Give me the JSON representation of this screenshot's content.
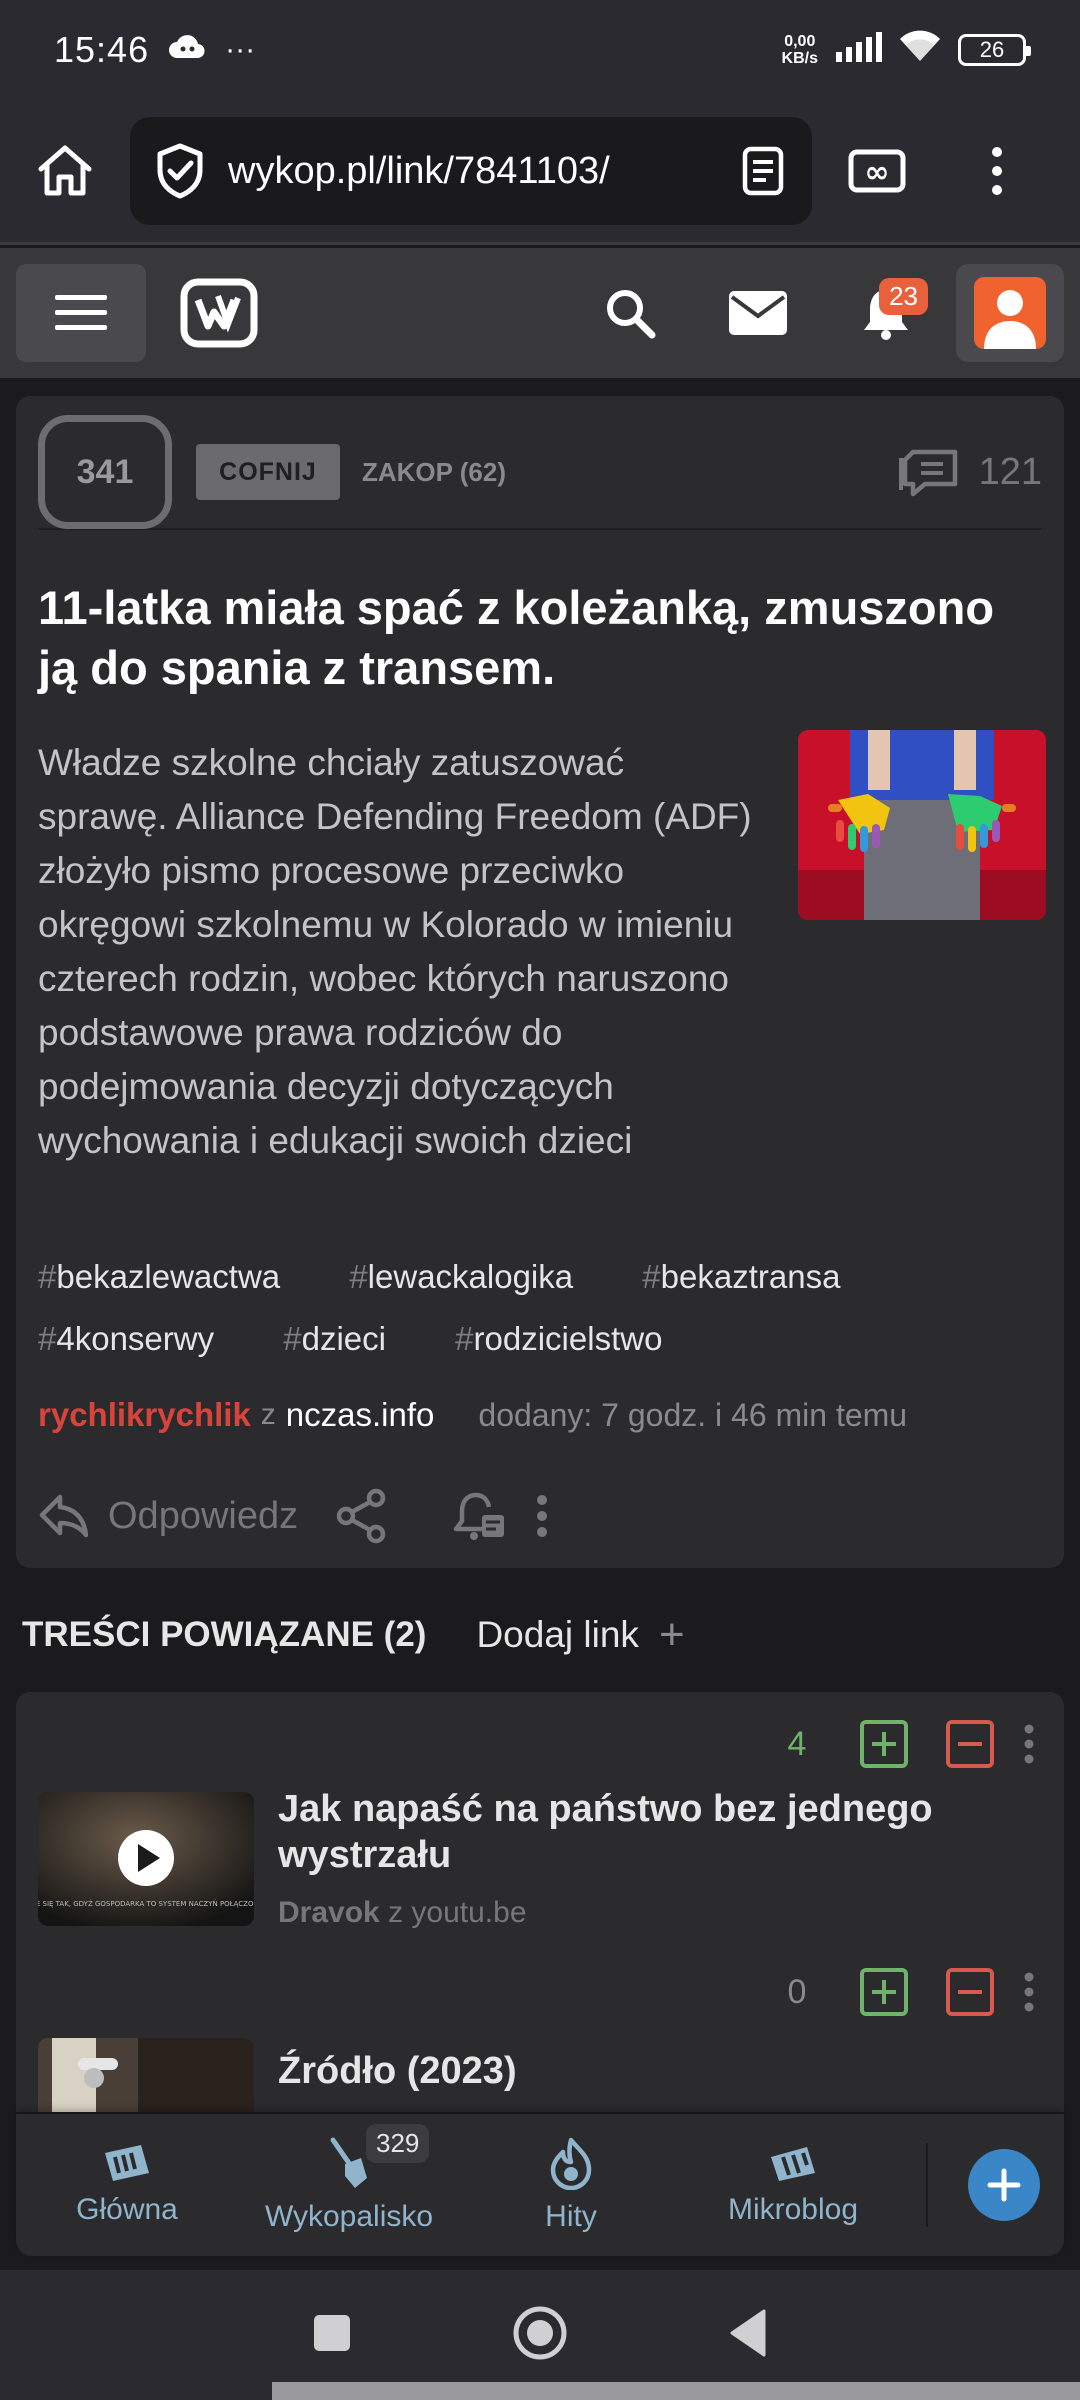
{
  "status_bar": {
    "time": "15:46",
    "more": "···",
    "net_speed_value": "0,00",
    "net_speed_unit": "KB/s",
    "battery": "26"
  },
  "browser": {
    "url": "wykop.pl/link/7841103/"
  },
  "header": {
    "notification_count": "23"
  },
  "article": {
    "votes": "341",
    "undo_label": "COFNIJ",
    "bury_label": "ZAKOP (62)",
    "comment_count": "121",
    "title": "11-latka miała spać z koleżanką, zmuszono ją do spania z transem.",
    "description": "Władze szkolne chciały zatuszować sprawę. Alliance Defending Freedom (ADF) złożyło pismo procesowe przeciwko okręgowi szkolnemu w Kolorado w imieniu czterech rodzin, wobec których naruszono podstawowe prawa rodziców do podejmowania decyzji dotyczących wychowania i edukacji swoich dzieci",
    "tags": [
      "bekazlewactwa",
      "lewackalogika",
      "bekaztransa",
      "4konserwy",
      "dzieci",
      "rodzicielstwo"
    ],
    "author": "rychlikrychlik",
    "from_word": "z",
    "source": "nczas.info",
    "added": "dodany: 7 godz. i 46 min temu",
    "reply_label": "Odpowiedz"
  },
  "related": {
    "heading": "TREŚCI POWIĄZANE (2)",
    "add_link_label": "Dodaj link",
    "add_plus": "+",
    "items": [
      {
        "votes": "4",
        "votes_color": "#6fb36a",
        "title": "Jak napaść na państwo bez jednego wystrzału",
        "author": "Dravok",
        "from_word": "z",
        "source": "youtu.be",
        "thumb_caption": "DZIEJE SIĘ TAK, GDYŻ GOSPODARKA TO SYSTEM NACZYŃ POŁĄCZONYCH."
      },
      {
        "votes": "0",
        "votes_color": "#8a8a8d",
        "title": "Źródło (2023)"
      }
    ]
  },
  "bottom_nav": {
    "items": [
      {
        "label": "Główna"
      },
      {
        "label": "Wykopalisko",
        "badge": "329"
      },
      {
        "label": "Hity"
      },
      {
        "label": "Mikroblog"
      }
    ]
  },
  "colors": {
    "accent_orange": "#e8603c",
    "author_red": "#d8443c",
    "vote_green": "#6fb36a",
    "vote_red": "#d7594f",
    "nav_blue": "#3a86c6"
  }
}
